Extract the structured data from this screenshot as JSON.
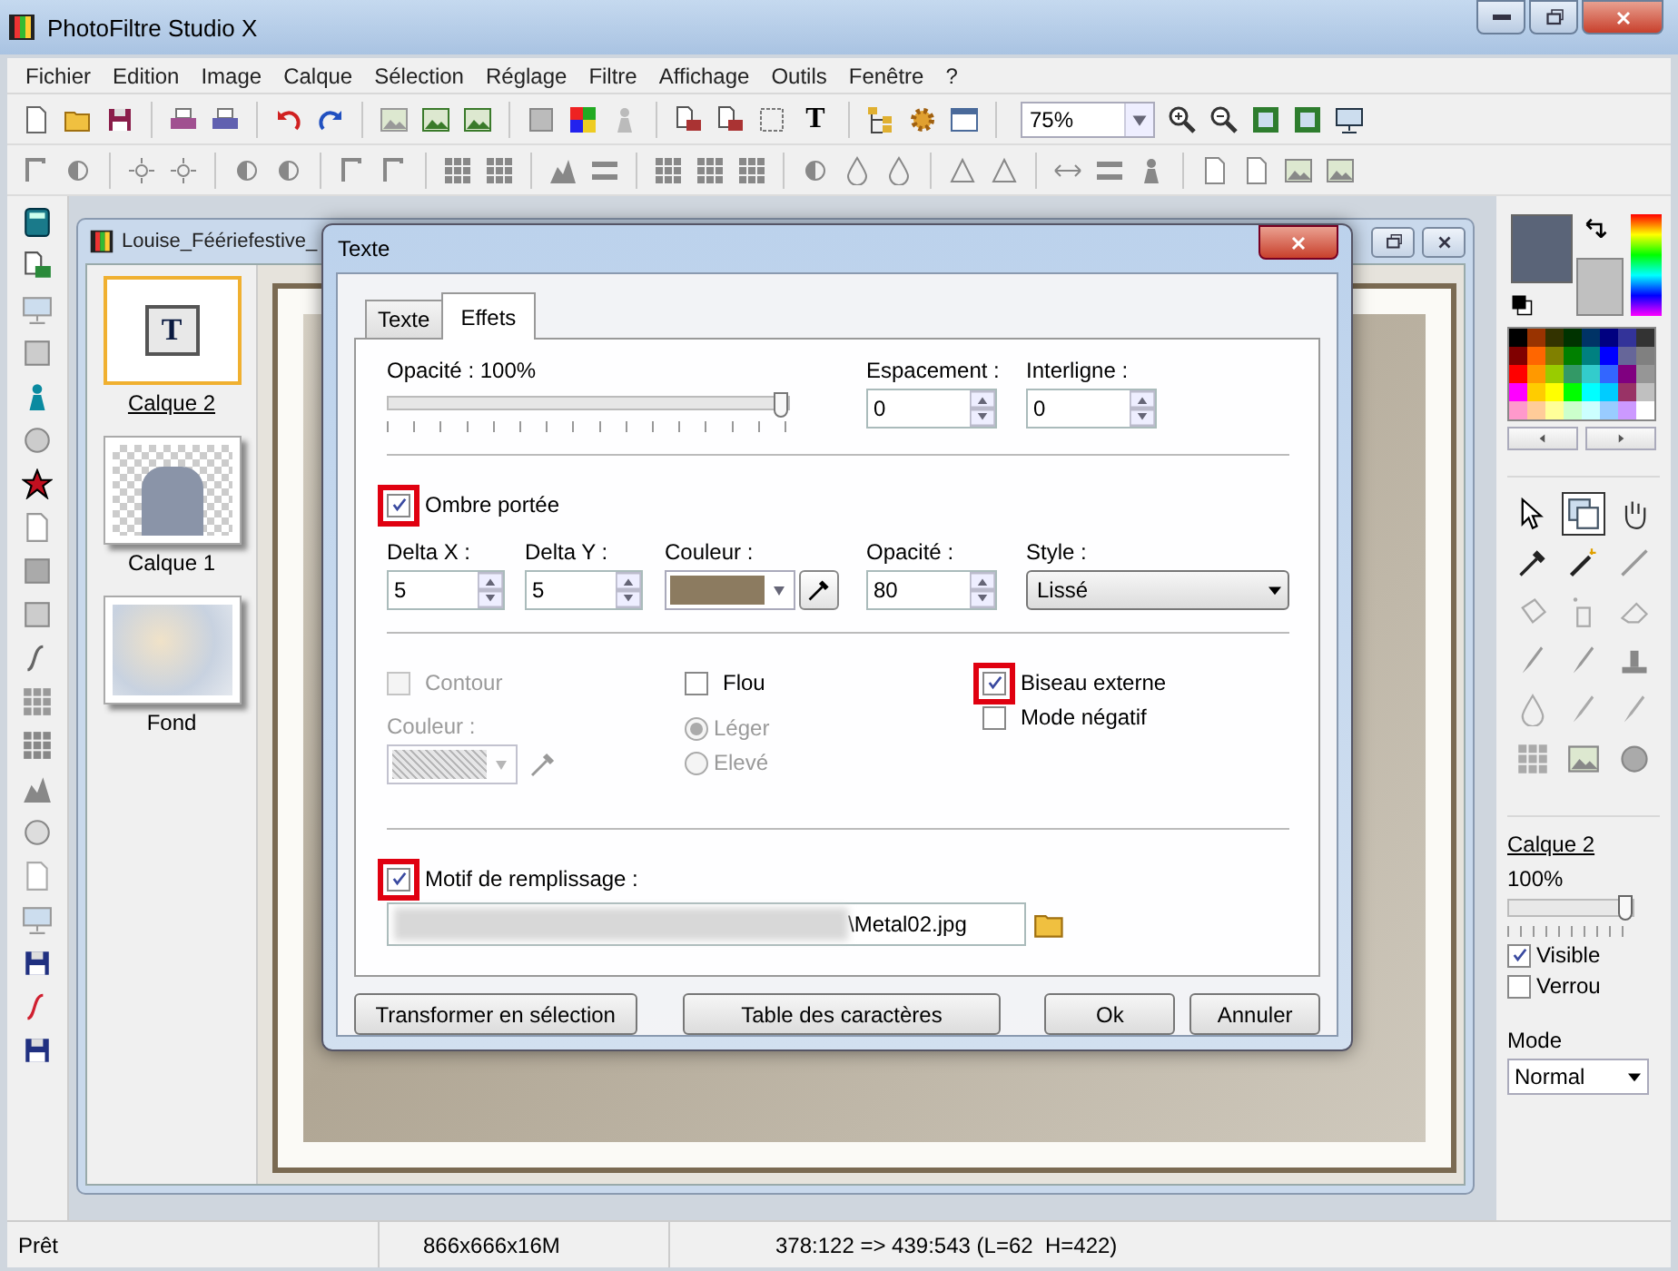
{
  "window": {
    "title": "PhotoFiltre Studio X"
  },
  "menu": [
    "Fichier",
    "Edition",
    "Image",
    "Calque",
    "Sélection",
    "Réglage",
    "Filtre",
    "Affichage",
    "Outils",
    "Fenêtre",
    "?"
  ],
  "toolbar": {
    "text_tool": "T",
    "zoom": "75%"
  },
  "document": {
    "title": "Louise_Féériefestive_",
    "layers": [
      {
        "name": "Calque 2",
        "kind": "text",
        "glyph": "T",
        "selected": true
      },
      {
        "name": "Calque 1",
        "kind": "photo",
        "selected": false
      },
      {
        "name": "Fond",
        "kind": "texture",
        "selected": false
      }
    ]
  },
  "dialog": {
    "title": "Texte",
    "tabs": [
      {
        "label": "Texte",
        "selected": false
      },
      {
        "label": "Effets",
        "selected": true
      }
    ],
    "opacity": {
      "label": "Opacité : 100%",
      "level": 1
    },
    "spacing": {
      "label": "Espacement :",
      "value": "0"
    },
    "line_spacing": {
      "label": "Interligne :",
      "value": "0"
    },
    "shadow": {
      "checkbox": {
        "label": "Ombre portée",
        "checked": true,
        "highlighted": true
      },
      "delta_x": {
        "label": "Delta X :",
        "value": "5"
      },
      "delta_y": {
        "label": "Delta Y :",
        "value": "5"
      },
      "color": {
        "label": "Couleur :",
        "color": "#8c7b60"
      },
      "opacity": {
        "label": "Opacité :",
        "value": "80"
      },
      "style": {
        "label": "Style :",
        "value": "Lissé"
      }
    },
    "outline": {
      "checkbox": {
        "label": "Contour",
        "checked": false,
        "highlighted": false,
        "disabled": true
      },
      "color_label": "Couleur :",
      "disabled": true
    },
    "blur": {
      "checkbox": {
        "label": "Flou",
        "checked": false,
        "highlighted": false,
        "disabled": false
      },
      "options": [
        {
          "label": "Léger",
          "selected": true
        },
        {
          "label": "Elevé",
          "selected": false
        }
      ],
      "disabled": true
    },
    "bevel": {
      "label": "Biseau externe",
      "checked": true,
      "highlighted": true
    },
    "negative": {
      "label": "Mode négatif",
      "checked": false,
      "highlighted": false
    },
    "pattern": {
      "checkbox": {
        "label": "Motif de remplissage :",
        "checked": true,
        "highlighted": true
      },
      "path": "\\Metal02.jpg"
    },
    "buttons": [
      "Transformer en sélection",
      "Table des caractères",
      "Ok",
      "Annuler"
    ]
  },
  "palette": {
    "current_colors": [
      {
        "color": "#5a6478"
      },
      {
        "color": "#c0c0c0"
      }
    ],
    "swatches": [
      {
        "color": "#000000"
      },
      {
        "color": "#993300"
      },
      {
        "color": "#333300"
      },
      {
        "color": "#003300"
      },
      {
        "color": "#003366"
      },
      {
        "color": "#000080"
      },
      {
        "color": "#333399"
      },
      {
        "color": "#333333"
      },
      {
        "color": "#800000"
      },
      {
        "color": "#ff6600"
      },
      {
        "color": "#808000"
      },
      {
        "color": "#008000"
      },
      {
        "color": "#008080"
      },
      {
        "color": "#0000ff"
      },
      {
        "color": "#666699"
      },
      {
        "color": "#808080"
      },
      {
        "color": "#ff0000"
      },
      {
        "color": "#ff9900"
      },
      {
        "color": "#99cc00"
      },
      {
        "color": "#339966"
      },
      {
        "color": "#33cccc"
      },
      {
        "color": "#3366ff"
      },
      {
        "color": "#800080"
      },
      {
        "color": "#969696"
      },
      {
        "color": "#ff00ff"
      },
      {
        "color": "#ffcc00"
      },
      {
        "color": "#ffff00"
      },
      {
        "color": "#00ff00"
      },
      {
        "color": "#00ffff"
      },
      {
        "color": "#00ccff"
      },
      {
        "color": "#993366"
      },
      {
        "color": "#c0c0c0"
      },
      {
        "color": "#ff99cc"
      },
      {
        "color": "#ffcc99"
      },
      {
        "color": "#ffff99"
      },
      {
        "color": "#ccffcc"
      },
      {
        "color": "#ccffff"
      },
      {
        "color": "#99ccff"
      },
      {
        "color": "#cc99ff"
      },
      {
        "color": "#ffffff"
      }
    ]
  },
  "layer_panel": {
    "name": "Calque 2",
    "opacity": "100%",
    "level": 1,
    "visible": {
      "label": "Visible",
      "checked": true
    },
    "lock": {
      "label": "Verrou",
      "checked": false
    },
    "mode_label": "Mode",
    "mode": "Normal"
  },
  "status_bar": [
    "Prêt",
    "866x666x16M",
    "378:122 => 439:543 (L=62  H=422)"
  ]
}
